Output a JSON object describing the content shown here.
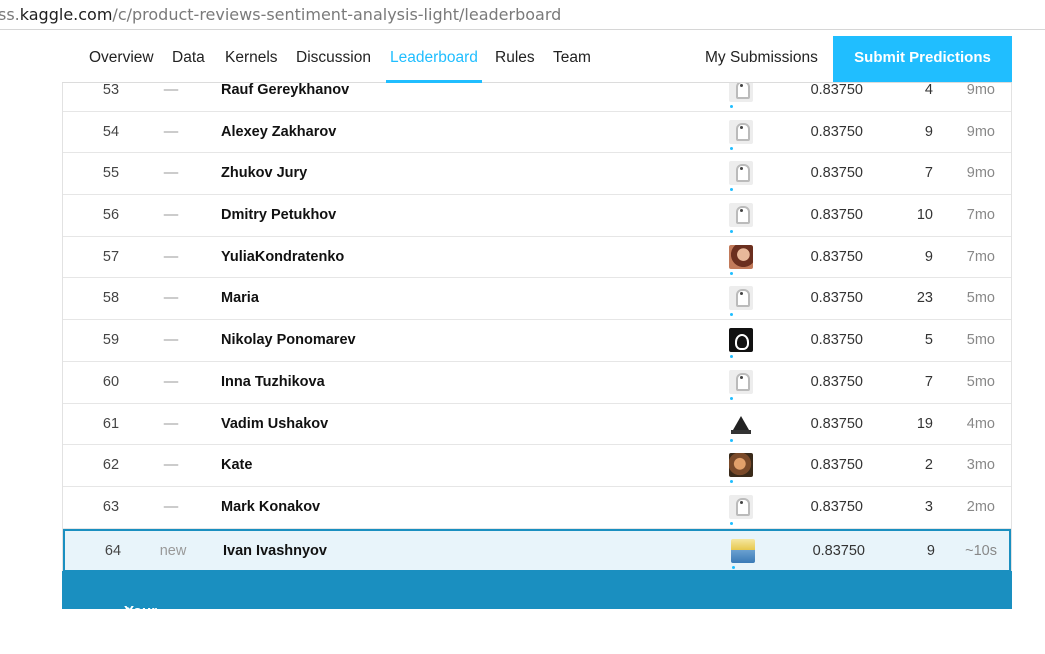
{
  "browser": {
    "url_prefix": "ss.",
    "url_domain": "kaggle.com",
    "url_path": "/c/product-reviews-sentiment-analysis-light/leaderboard"
  },
  "nav": {
    "tabs": [
      {
        "label": "Overview"
      },
      {
        "label": "Data"
      },
      {
        "label": "Kernels"
      },
      {
        "label": "Discussion"
      },
      {
        "label": "Leaderboard",
        "active": true
      },
      {
        "label": "Rules"
      },
      {
        "label": "Team"
      }
    ],
    "my_submissions": "My Submissions",
    "submit": "Submit Predictions"
  },
  "colors": {
    "accent": "#20beff",
    "highlight": "#1a8fc0"
  },
  "rows": [
    {
      "rank": "53",
      "delta": "—",
      "name": "Rauf Gereykhanov",
      "avatar": "goose",
      "score": "0.83750",
      "entries": "4",
      "last": "9mo"
    },
    {
      "rank": "54",
      "delta": "—",
      "name": "Alexey Zakharov",
      "avatar": "goose",
      "score": "0.83750",
      "entries": "9",
      "last": "9mo"
    },
    {
      "rank": "55",
      "delta": "—",
      "name": "Zhukov Jury",
      "avatar": "goose",
      "score": "0.83750",
      "entries": "7",
      "last": "9mo"
    },
    {
      "rank": "56",
      "delta": "—",
      "name": "Dmitry Petukhov",
      "avatar": "goose",
      "score": "0.83750",
      "entries": "10",
      "last": "7mo"
    },
    {
      "rank": "57",
      "delta": "—",
      "name": "YuliaKondratenko",
      "avatar": "woman",
      "score": "0.83750",
      "entries": "9",
      "last": "7mo"
    },
    {
      "rank": "58",
      "delta": "—",
      "name": "Maria",
      "avatar": "goose",
      "score": "0.83750",
      "entries": "23",
      "last": "5mo"
    },
    {
      "rank": "59",
      "delta": "—",
      "name": "Nikolay Ponomarev",
      "avatar": "bw",
      "score": "0.83750",
      "entries": "5",
      "last": "5mo"
    },
    {
      "rank": "60",
      "delta": "—",
      "name": "Inna Tuzhikova",
      "avatar": "goose",
      "score": "0.83750",
      "entries": "7",
      "last": "5mo"
    },
    {
      "rank": "61",
      "delta": "—",
      "name": "Vadim Ushakov",
      "avatar": "ship",
      "score": "0.83750",
      "entries": "19",
      "last": "4mo"
    },
    {
      "rank": "62",
      "delta": "—",
      "name": "Kate",
      "avatar": "kate",
      "score": "0.83750",
      "entries": "2",
      "last": "3mo"
    },
    {
      "rank": "63",
      "delta": "—",
      "name": "Mark Konakov",
      "avatar": "goose",
      "score": "0.83750",
      "entries": "3",
      "last": "2mo"
    },
    {
      "rank": "64",
      "delta": "new",
      "name": "Ivan Ivashnyov",
      "avatar": "ivan",
      "score": "0.83750",
      "entries": "9",
      "last": "~10s",
      "you": true
    }
  ],
  "banner": {
    "label": "Your Best Entry",
    "icon": "arrow-up-icon"
  }
}
